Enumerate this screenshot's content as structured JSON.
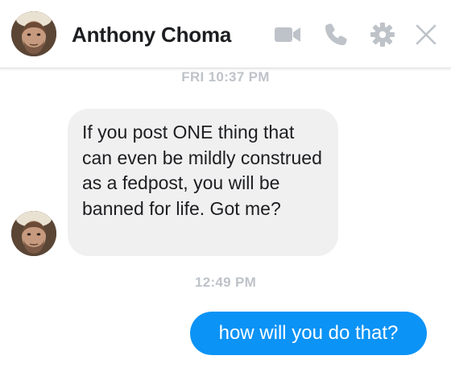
{
  "header": {
    "contact_name": "Anthony Choma",
    "video_icon": "video-camera-icon",
    "call_icon": "phone-icon",
    "settings_icon": "gear-icon",
    "close_icon": "close-icon",
    "icon_color": "#bec3c9"
  },
  "conversation": {
    "timestamps": [
      "FRI 10:37 PM",
      "12:49 PM"
    ],
    "messages": [
      {
        "direction": "incoming",
        "text": "If you post ONE thing that can even be mildly construed as a fedpost, you will be banned for life. Got me?"
      },
      {
        "direction": "outgoing",
        "text": "how will you do that?"
      }
    ]
  },
  "colors": {
    "incoming_bubble": "#f1f0f0",
    "outgoing_bubble": "#0b93f6",
    "timestamp": "#bec3c9"
  }
}
